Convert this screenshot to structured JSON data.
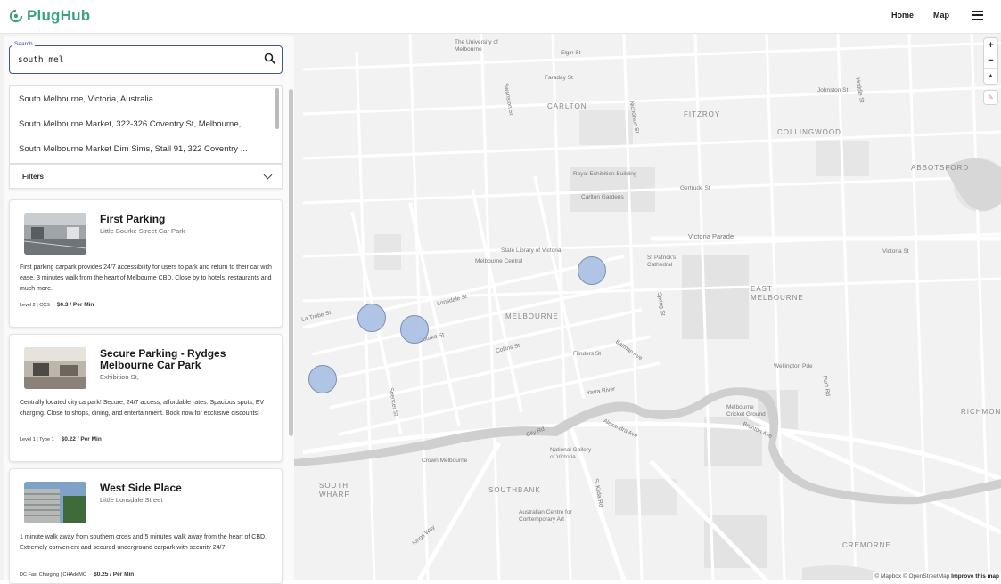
{
  "header": {
    "logo_text": "PlugHub",
    "nav": {
      "home": "Home",
      "map": "Map"
    }
  },
  "search": {
    "legend": "Search",
    "value": "south mel"
  },
  "suggestions": [
    "South Melbourne, Victoria, Australia",
    "South Melbourne Market, 322-326 Coventry St, Melbourne, ...",
    "South Melbourne Market Dim Sims, Stall 91, 322 Coventry ..."
  ],
  "filters": {
    "label": "Filters"
  },
  "listings": [
    {
      "title": "First Parking",
      "subtitle": "Little Bourke Street Car Park",
      "description": "First parking carpark provides 24/7 accessibility for users to park and return to their car with ease. 3 minutes walk from the heart of Melbourne CBD. Close by to hotels, restaurants and much more.",
      "plug": "Level 2 | CCS",
      "price": "$0.3 / Per Min"
    },
    {
      "title": "Secure Parking - Rydges Melbourne Car Park",
      "subtitle": "Exhibition St,",
      "description": "Centrally located city carpark! Secure, 24/7 access, affordable rates. Spacious spots, EV charging. Close to shops, dining, and entertainment. Book now for exclusive discounts!",
      "plug": "Level 1 | Type 1",
      "price": "$0.22 / Per Min"
    },
    {
      "title": "West Side Place",
      "subtitle": "Little Lonsdale Street",
      "description": "1 minute walk away from southern cross and 5 minutes walk away from the heart of CBD. Extremely convenient and secured underground carpark with security 24/7",
      "plug": "DC Fast Charging | CHAdeMO",
      "price": "$0.25 / Per Min"
    }
  ],
  "map": {
    "controls": {
      "zoom_in": "+",
      "zoom_out": "−",
      "compass": "▲"
    },
    "attribution": {
      "text": "© Mapbox © OpenStreetMap",
      "link": "Improve this map"
    },
    "labels": {
      "carlton": "CARLTON",
      "fitzroy": "FITZROY",
      "collingwood": "COLLINGWOOD",
      "abbotsford": "ABBOTSFORD",
      "east_melbourne": "EAST MELBOURNE",
      "melbourne": "MELBOURNE",
      "richmond": "RICHMOND",
      "southbank": "SOUTHBANK",
      "south_wharf": "SOUTH WHARF",
      "cremorne": "CREMORNE",
      "victoria_parade": "Victoria Parade",
      "flinders_st": "Flinders St",
      "yarra_river": "Yarra River",
      "lonsdale_st": "Lonsdale St",
      "collins_st": "Collins St",
      "bourke_st": "Bourke St",
      "la_trobe_st": "La Trobe St",
      "elgin_st": "Elgin St",
      "faraday_st": "Faraday St",
      "johnston_st": "Johnston St",
      "gertrude_st": "Gertrude St",
      "nicholson_st": "Nicholson St",
      "exhibition_building": "Royal Exhibition Building",
      "carlton_gardens": "Carlton Gardens",
      "state_library": "State Library of Victoria",
      "melbourne_central": "Melbourne Central",
      "st_patricks": "St Patrick's Cathedral",
      "university": "The University of Melbourne",
      "victoria_st": "Victoria St",
      "hoddle_st": "Hoddle St",
      "punt_rd": "Punt Rd",
      "city_rd": "City Rd",
      "st_kilda_rd": "St Kilda Rd",
      "alexandra_ave": "Alexandra Ave",
      "kings_way": "Kings Way",
      "spencer_st": "Spencer St",
      "swanston_st": "Swanston St",
      "spring_st": "Spring St",
      "wellington_pde": "Wellington Pde",
      "brunton_ave": "Brunton Ave",
      "batman_ave": "Batman Ave",
      "cricket_ground": "Melbourne Cricket Ground",
      "crown": "Crown Melbourne",
      "ngv": "National Gallery of Victoria",
      "acca": "Australian Centre for Contemporary Art"
    }
  }
}
